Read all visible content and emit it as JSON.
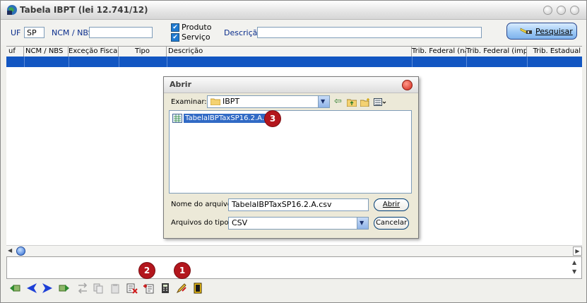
{
  "window": {
    "title": "Tabela IBPT (lei 12.741/12)"
  },
  "filters": {
    "uf_label": "UF",
    "uf_value": "SP",
    "ncm_label": "NCM / NBS",
    "ncm_value": "",
    "produto_label": "Produto",
    "produto_checked": true,
    "servico_label": "Serviço",
    "servico_checked": true,
    "descricao_label": "Descrição",
    "descricao_value": "",
    "search_label": "Pesquisar"
  },
  "grid": {
    "columns": [
      "uf",
      "NCM / NBS",
      "Exceção Fiscal",
      "Tipo",
      "Descrição",
      "Trib. Federal (nac)",
      "Trib. Federal (imp)",
      "Trib. Estadual"
    ]
  },
  "dialog": {
    "title": "Abrir",
    "look_in_label": "Examinar:",
    "look_in_value": "IBPT",
    "files": [
      "TabelaIBPTaxSP16.2.A.csv"
    ],
    "filename_label": "Nome do arquivo:",
    "filename_value": "TabelaIBPTaxSP16.2.A.csv",
    "filetype_label": "Arquivos do tipo:",
    "filetype_value": "CSV",
    "open_label": "Abrir",
    "cancel_label": "Cancelar"
  },
  "badges": {
    "one": "1",
    "two": "2",
    "three": "3"
  },
  "toolbar_icons": [
    "back-to-list-icon",
    "previous-icon",
    "next-icon",
    "forward-icon",
    "arrows-icon",
    "copy-icon",
    "paste-icon",
    "export-icon",
    "import-icon",
    "calculator-icon",
    "edit-icon",
    "exit-icon"
  ],
  "colors": {
    "selection": "#1256c2",
    "badge": "#b3161d",
    "label": "#0a2d8c"
  }
}
